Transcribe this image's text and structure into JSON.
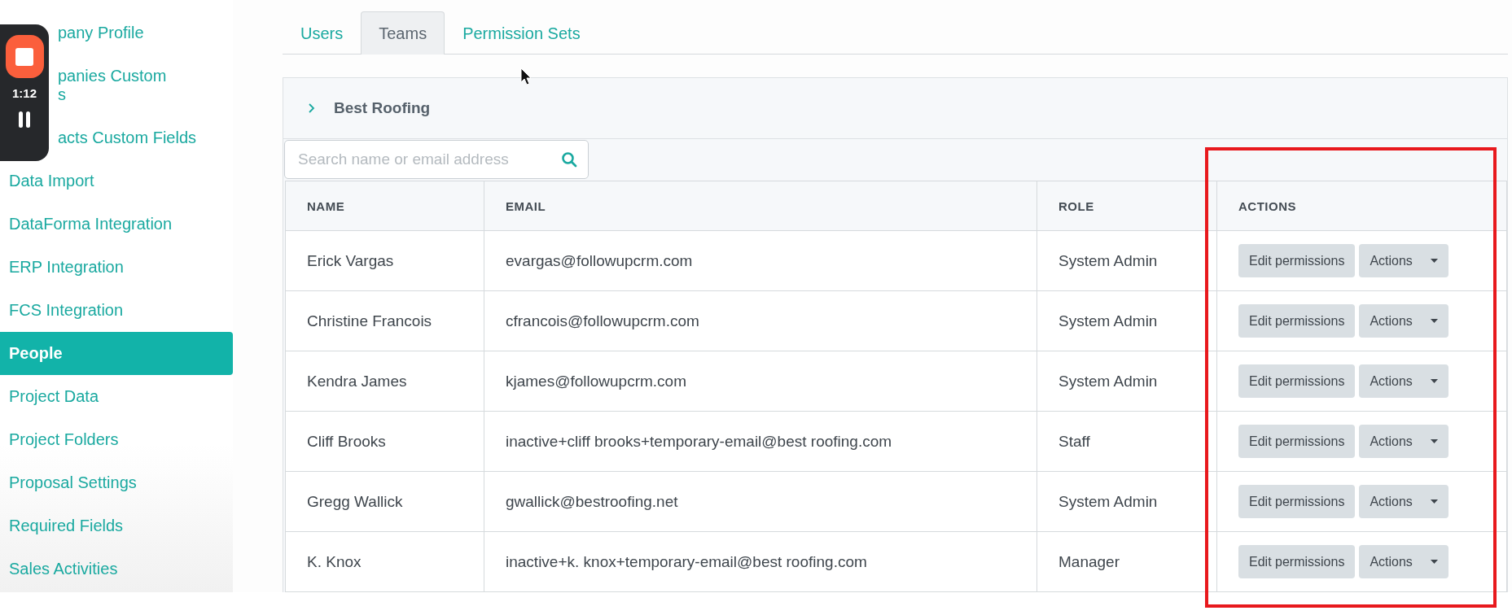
{
  "recorder": {
    "time": "1:12"
  },
  "sidebar": {
    "items": [
      {
        "lines": [
          "pany Profile"
        ],
        "selected": false
      },
      {
        "lines": [
          "panies Custom",
          "s"
        ],
        "selected": false
      },
      {
        "lines": [
          "acts Custom Fields"
        ],
        "selected": false
      },
      {
        "lines": [
          "Data Import"
        ],
        "selected": false
      },
      {
        "lines": [
          "DataForma Integration"
        ],
        "selected": false
      },
      {
        "lines": [
          "ERP Integration"
        ],
        "selected": false
      },
      {
        "lines": [
          "FCS Integration"
        ],
        "selected": false
      },
      {
        "lines": [
          "People"
        ],
        "selected": true
      },
      {
        "lines": [
          "Project Data"
        ],
        "selected": false
      },
      {
        "lines": [
          "Project Folders"
        ],
        "selected": false
      },
      {
        "lines": [
          "Proposal Settings"
        ],
        "selected": false
      },
      {
        "lines": [
          "Required Fields"
        ],
        "selected": false
      },
      {
        "lines": [
          "Sales Activities"
        ],
        "selected": false
      }
    ]
  },
  "tabs": [
    {
      "label": "Users",
      "selected": false
    },
    {
      "label": "Teams",
      "selected": true
    },
    {
      "label": "Permission Sets",
      "selected": false
    }
  ],
  "team": {
    "name": "Best Roofing",
    "expanded": false
  },
  "search": {
    "placeholder": "Search name or email address"
  },
  "table": {
    "columns": [
      "NAME",
      "EMAIL",
      "ROLE",
      "ACTIONS"
    ],
    "rows": [
      {
        "name": "Erick Vargas",
        "email": "evargas@followupcrm.com",
        "role": "System Admin",
        "edit": "Edit permissions",
        "actions": "Actions"
      },
      {
        "name": "Christine Francois",
        "email": "cfrancois@followupcrm.com",
        "role": "System Admin",
        "edit": "Edit permissions",
        "actions": "Actions"
      },
      {
        "name": "Kendra James",
        "email": "kjames@followupcrm.com",
        "role": "System Admin",
        "edit": "Edit permissions",
        "actions": "Actions"
      },
      {
        "name": "Cliff Brooks",
        "email": "inactive+cliff brooks+temporary-email@best roofing.com",
        "role": "Staff",
        "edit": "Edit permissions",
        "actions": "Actions"
      },
      {
        "name": "Gregg Wallick",
        "email": "gwallick@bestroofing.net",
        "role": "System Admin",
        "edit": "Edit permissions",
        "actions": "Actions"
      },
      {
        "name": "K. Knox",
        "email": "inactive+k. knox+temporary-email@best roofing.com",
        "role": "Manager",
        "edit": "Edit permissions",
        "actions": "Actions"
      }
    ]
  }
}
